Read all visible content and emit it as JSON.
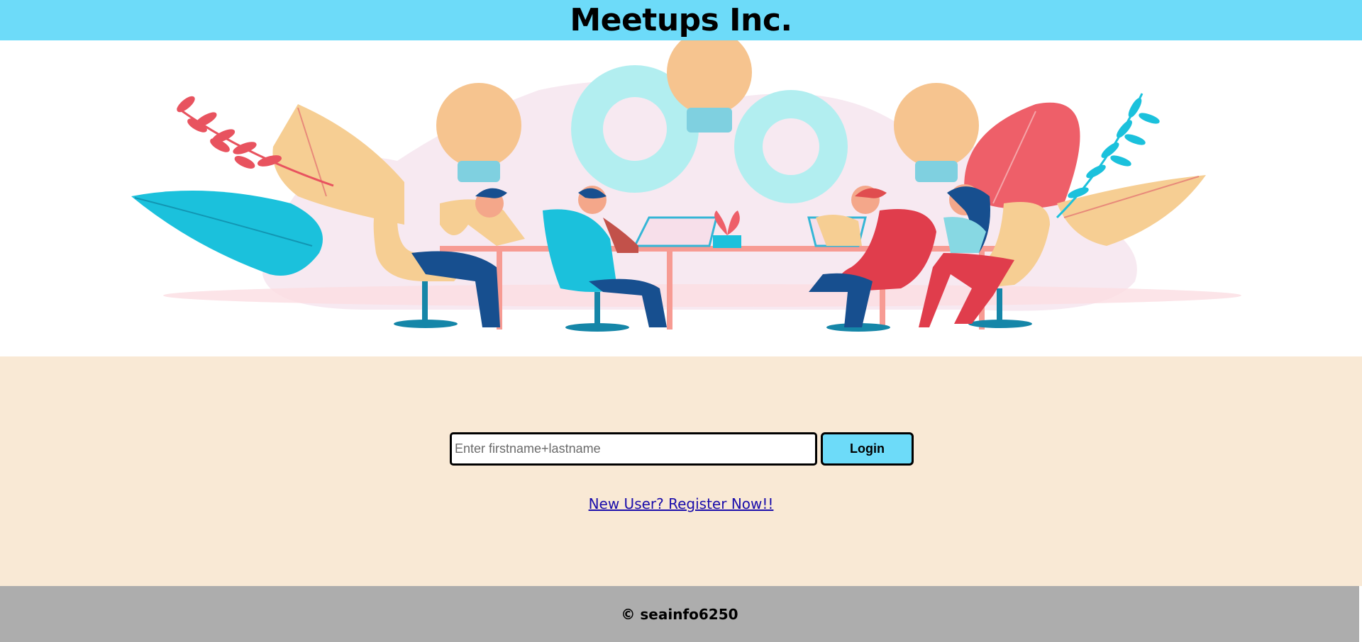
{
  "header": {
    "title": "Meetups Inc."
  },
  "hero": {
    "illustration": "team-meeting-illustration"
  },
  "login": {
    "name_placeholder": "Enter firstname+lastname",
    "name_value": "",
    "login_label": "Login",
    "register_label": "New User? Register Now!!"
  },
  "footer": {
    "copyright": "© seainfo6250"
  },
  "colors": {
    "header_bg": "#6ddbf9",
    "login_bg": "#f9e9d5",
    "footer_bg": "#adadad",
    "link": "#1a0dab"
  }
}
